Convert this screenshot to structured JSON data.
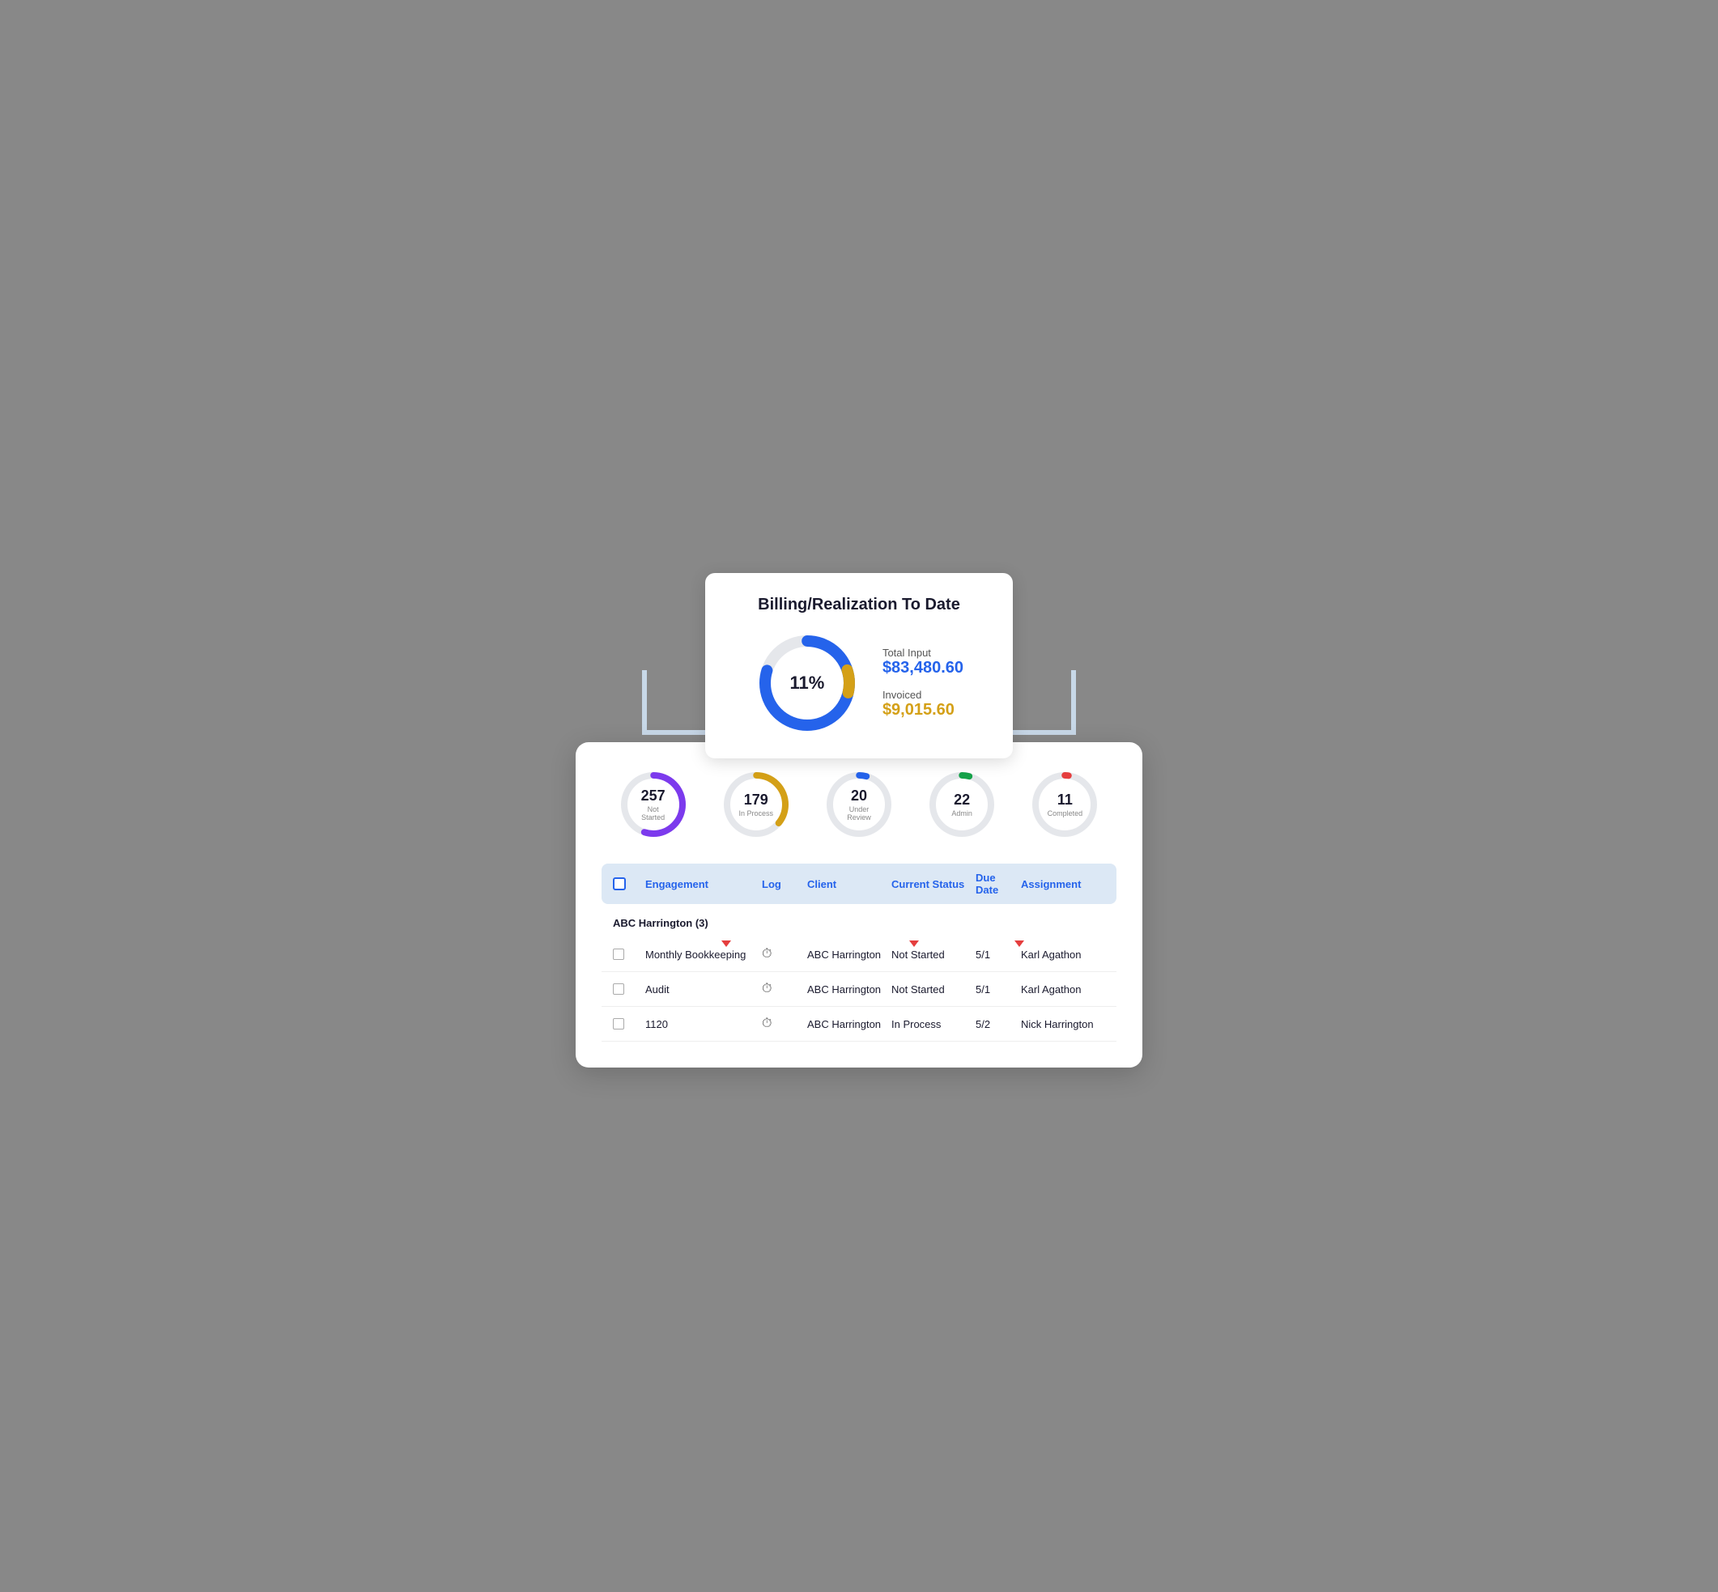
{
  "billing": {
    "title": "Billing/Realization To Date",
    "percent": "11%",
    "total_input_label": "Total Input",
    "total_input_value": "$83,480.60",
    "invoiced_label": "Invoiced",
    "invoiced_value": "$9,015.60",
    "donut": {
      "blue_color": "#2563eb",
      "yellow_color": "#d4a017",
      "gray_color": "#e5e7eb",
      "blue_pct": 82,
      "yellow_pct": 9,
      "gray_pct": 9
    }
  },
  "stats": [
    {
      "number": "257",
      "label": "Not Started",
      "color": "#7c3aed",
      "pct": 55
    },
    {
      "number": "179",
      "label": "In Process",
      "color": "#d4a017",
      "pct": 36
    },
    {
      "number": "20",
      "label": "Under Review",
      "color": "#2563eb",
      "pct": 4
    },
    {
      "number": "22",
      "label": "Admin",
      "color": "#16a34a",
      "pct": 4
    },
    {
      "number": "11",
      "label": "Completed",
      "color": "#e53e3e",
      "pct": 2
    }
  ],
  "table": {
    "headers": {
      "engagement": "Engagement",
      "log": "Log",
      "client": "Client",
      "current_status": "Current Status",
      "due_date": "Due Date",
      "assignment": "Assignment"
    },
    "group": "ABC Harrington (3)",
    "rows": [
      {
        "engagement": "Monthly Bookkeeping",
        "client": "ABC Harrington",
        "status": "Not Started",
        "due_date": "5/1",
        "assignment": "Karl Agathon",
        "has_arrows": true
      },
      {
        "engagement": "Audit",
        "client": "ABC Harrington",
        "status": "Not Started",
        "due_date": "5/1",
        "assignment": "Karl Agathon",
        "has_arrows": false
      },
      {
        "engagement": "1120",
        "client": "ABC Harrington",
        "status": "In Process",
        "due_date": "5/2",
        "assignment": "Nick Harrington",
        "has_arrows": false
      }
    ]
  }
}
